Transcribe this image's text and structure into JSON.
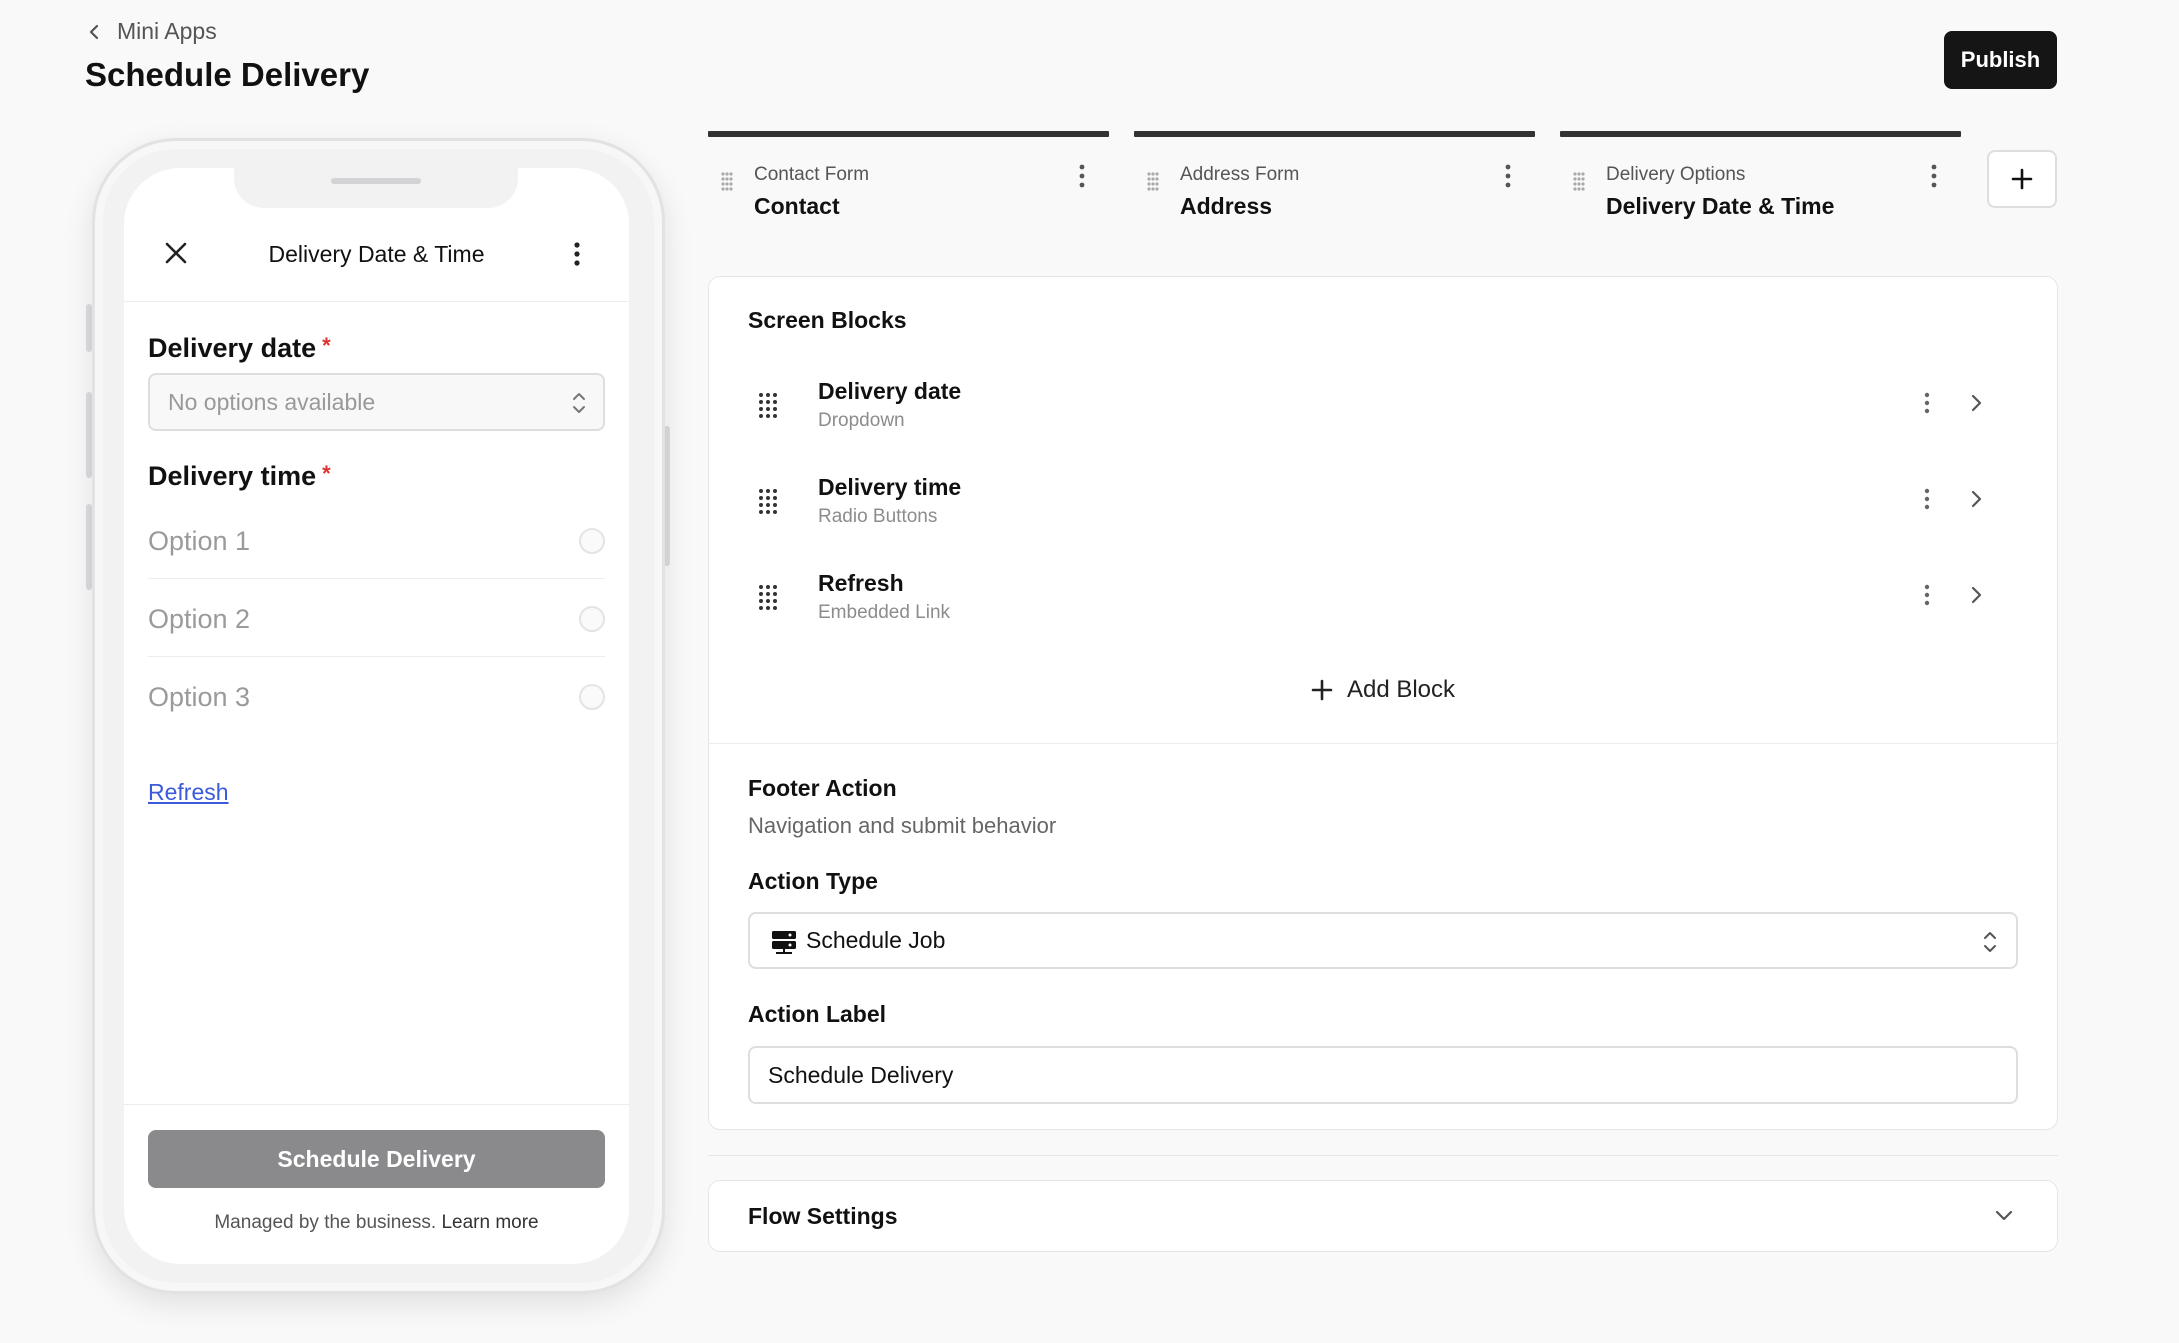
{
  "header": {
    "back_label": "Mini Apps",
    "title": "Schedule Delivery",
    "publish_label": "Publish"
  },
  "phone": {
    "screen_title": "Delivery Date & Time",
    "delivery_date_label": "Delivery date",
    "delivery_time_label": "Delivery time",
    "required_mark": "*",
    "date_placeholder": "No options available",
    "options": [
      "Option 1",
      "Option 2",
      "Option 3"
    ],
    "refresh_link": "Refresh",
    "submit_label": "Schedule Delivery",
    "footnote": "Managed by the business.",
    "learn_more": "Learn more"
  },
  "steps": [
    {
      "sub": "Contact Form",
      "name": "Contact"
    },
    {
      "sub": "Address Form",
      "name": "Address"
    },
    {
      "sub": "Delivery Options",
      "name": "Delivery Date & Time"
    }
  ],
  "screen_blocks": {
    "title": "Screen Blocks",
    "items": [
      {
        "name": "Delivery date",
        "type": "Dropdown"
      },
      {
        "name": "Delivery time",
        "type": "Radio Buttons"
      },
      {
        "name": "Refresh",
        "type": "Embedded Link"
      }
    ],
    "add_label": "Add Block"
  },
  "footer_action": {
    "title": "Footer Action",
    "subtitle": "Navigation and submit behavior",
    "action_type_label": "Action Type",
    "action_type_value": "Schedule Job",
    "action_label_label": "Action Label",
    "action_label_value": "Schedule Delivery"
  },
  "flow_settings": {
    "title": "Flow Settings"
  }
}
